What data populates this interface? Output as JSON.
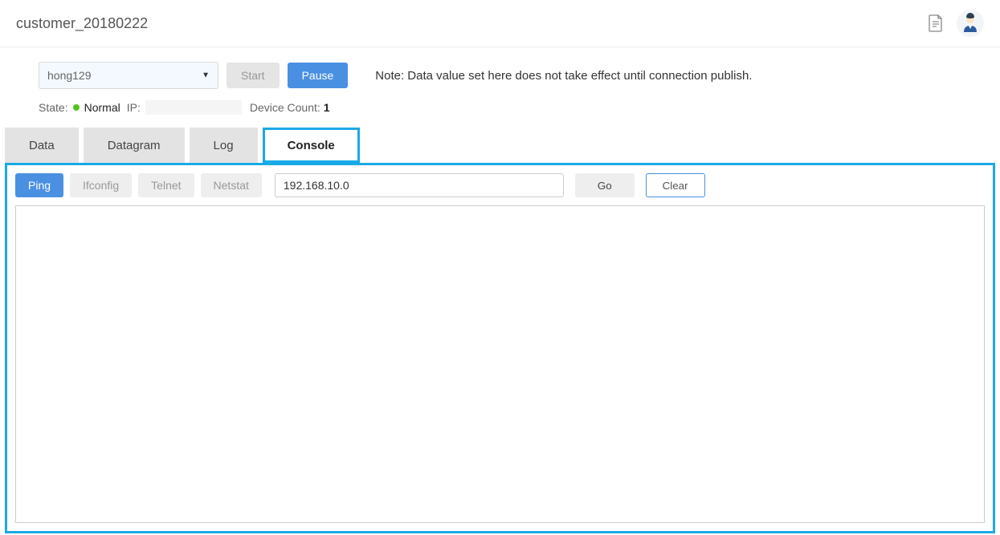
{
  "header": {
    "title": "customer_20180222"
  },
  "controls": {
    "select_value": "hong129",
    "start_label": "Start",
    "pause_label": "Pause",
    "note": "Note: Data value set here does not take effect until connection publish."
  },
  "status": {
    "state_label": "State:",
    "state_value": "Normal",
    "ip_label": "IP:",
    "ip_value": "",
    "device_count_label": "Device Count:",
    "device_count_value": "1"
  },
  "tabs": {
    "data": "Data",
    "datagram": "Datagram",
    "log": "Log",
    "console": "Console"
  },
  "console": {
    "ping": "Ping",
    "ifconfig": "Ifconfig",
    "telnet": "Telnet",
    "netstat": "Netstat",
    "input_value": "192.168.10.0",
    "go": "Go",
    "clear": "Clear"
  }
}
